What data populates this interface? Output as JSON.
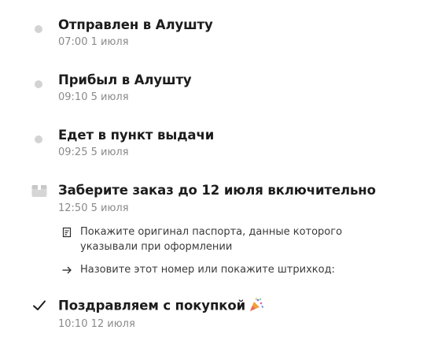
{
  "events": [
    {
      "title": "Отправлен в Алушту",
      "time": "07:00",
      "date": "1 июля",
      "icon": "gray-dot-icon"
    },
    {
      "title": "Прибыл в Алушту",
      "time": "09:10",
      "date": "5 июля",
      "icon": "gray-dot-icon"
    },
    {
      "title": "Едет в пункт выдачи",
      "time": "09:25",
      "date": "5 июля",
      "icon": "gray-dot-icon"
    },
    {
      "title": "Заберите заказ до 12 июля включительно",
      "time": "12:50",
      "date": "5 июля",
      "icon": "pickup-box-icon",
      "notes": [
        {
          "icon": "document-icon",
          "text": "Покажите оригинал паспорта, данные которого указывали при оформлении"
        },
        {
          "icon": "arrow-right-icon",
          "text": "Назовите этот номер или покажите штрихкод:"
        }
      ]
    },
    {
      "title": "Поздравляем с покупкой",
      "time": "10:10",
      "date": "12 июля",
      "icon": "checkmark-icon",
      "emoji": "party-popper-icon"
    }
  ],
  "colors": {
    "dot": "#d3d3d3",
    "title": "#1c1c1c",
    "time": "#8a8a8a"
  }
}
